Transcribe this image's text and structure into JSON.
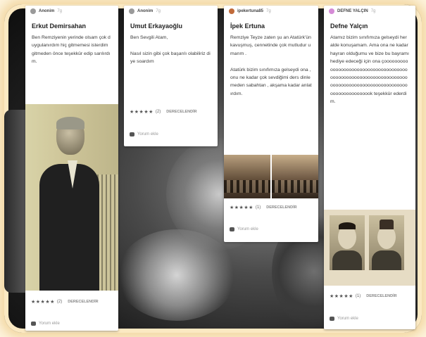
{
  "cards": [
    {
      "author": "Anonim",
      "time": "7g",
      "title": "Erkut Demirsahan",
      "text": "Ben Remziyenin yerinde olsam çok duygulanırdım hiç gitmemesi isterdim gitmeden önce teşekkür edip sarılırdım.",
      "stars": "★★★★★",
      "rating_count": "(2)",
      "rate_label": "DERECELENDİR",
      "comment_label": "Yorum ekle",
      "avatar_color": "#9a9a9a"
    },
    {
      "author": "Anonim",
      "time": "7g",
      "title": "Umut Erkayaoğlu",
      "text": "Ben Sevgili Atam,\n\nNasıl sizin gibi çok başarılı olabiliriz diye soardım",
      "stars": "★★★★★",
      "rating_count": "(2)",
      "rate_label": "DERECELENDİR",
      "comment_label": "Yorum ekle",
      "avatar_color": "#9a9a9a"
    },
    {
      "author": "ipekertuna85",
      "time": "7g",
      "title": "İpek Ertuna",
      "text": "Remziye Teyze zaten şu an Atatürk'ün kavuşmuş, cennetinde çok mutludur umarım .\n\nAtatürk bizim sınıfımıza gelseydi ona , onu ne kadar çok sevdiğimi ders dinlemeden sabahtan , akşama kadar anlatırdım.",
      "stars": "★★★★★",
      "rating_count": "(1)",
      "rate_label": "DERECELENDİR",
      "comment_label": "Yorum ekle",
      "avatar_color": "#c06a3a"
    },
    {
      "author": "DEFNE YALÇIN",
      "time": "7g",
      "title": "Defne Yalçın",
      "text": "Atamız bizim sınıfımıza gelseydi heralde konuşamam. Ama ona ne kadar hayran olduğumu ve bize bu bayramı hediye edeceği için ona çoooooooooooooooooooooooooooooooooooooooooooooooooooooooooooooooooooooooooooooooooooooooooooooooooooooooooooooook teşekkür ederdim.",
      "stars": "★★★★★",
      "rating_count": "(1)",
      "rate_label": "DERECELENDİR",
      "comment_label": "Yorum ekle",
      "avatar_color": "#d58bd6"
    }
  ]
}
